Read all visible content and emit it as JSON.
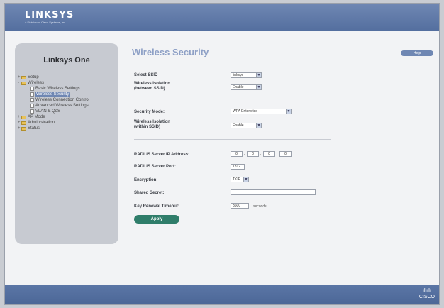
{
  "brand": {
    "logo": "LINKSYS",
    "sub": "A Division of Cisco Systems, Inc.",
    "footer_logo": "CISCO",
    "footer_bars": "ılıılı"
  },
  "sidebar": {
    "title": "Linksys One",
    "items": [
      {
        "label": "Setup",
        "level": 0,
        "type": "folder"
      },
      {
        "label": "Wireless",
        "level": 0,
        "type": "folder"
      },
      {
        "label": "Basic Wireless Settings",
        "level": 1,
        "type": "doc"
      },
      {
        "label": "Wireless Security",
        "level": 1,
        "type": "doc",
        "selected": true
      },
      {
        "label": "Wireless Connection Control",
        "level": 1,
        "type": "doc"
      },
      {
        "label": "Advanced Wireless Settings",
        "level": 1,
        "type": "doc"
      },
      {
        "label": "VLAN & QoS",
        "level": 1,
        "type": "doc"
      },
      {
        "label": "AP Mode",
        "level": 0,
        "type": "folder"
      },
      {
        "label": "Administration",
        "level": 0,
        "type": "folder"
      },
      {
        "label": "Status",
        "level": 0,
        "type": "folder"
      }
    ]
  },
  "main": {
    "title": "Wireless Security",
    "help_label": "Help",
    "select_ssid": {
      "label": "Select SSID",
      "value": "linksys"
    },
    "isolation_between": {
      "label_1": "Wireless Isolation",
      "label_2": "(between SSID)",
      "value": "Enable"
    },
    "security_mode": {
      "label": "Security Mode:",
      "value": "WPA Enterprise"
    },
    "isolation_within": {
      "label_1": "Wireless Isolation",
      "label_2": "(within SSID)",
      "value": "Enable"
    },
    "radius_ip": {
      "label": "RADIUS Server IP Address:",
      "octets": [
        "0",
        "0",
        "0",
        "0"
      ]
    },
    "radius_port": {
      "label": "RADIUS Server Port:",
      "value": "1812"
    },
    "encryption": {
      "label": "Encryption:",
      "value": "TKIP"
    },
    "shared_secret": {
      "label": "Shared Secret:",
      "value": ""
    },
    "key_renewal": {
      "label": "Key Renewal Timeout:",
      "value": "3600",
      "unit": "seconds"
    },
    "apply_label": "Apply"
  }
}
